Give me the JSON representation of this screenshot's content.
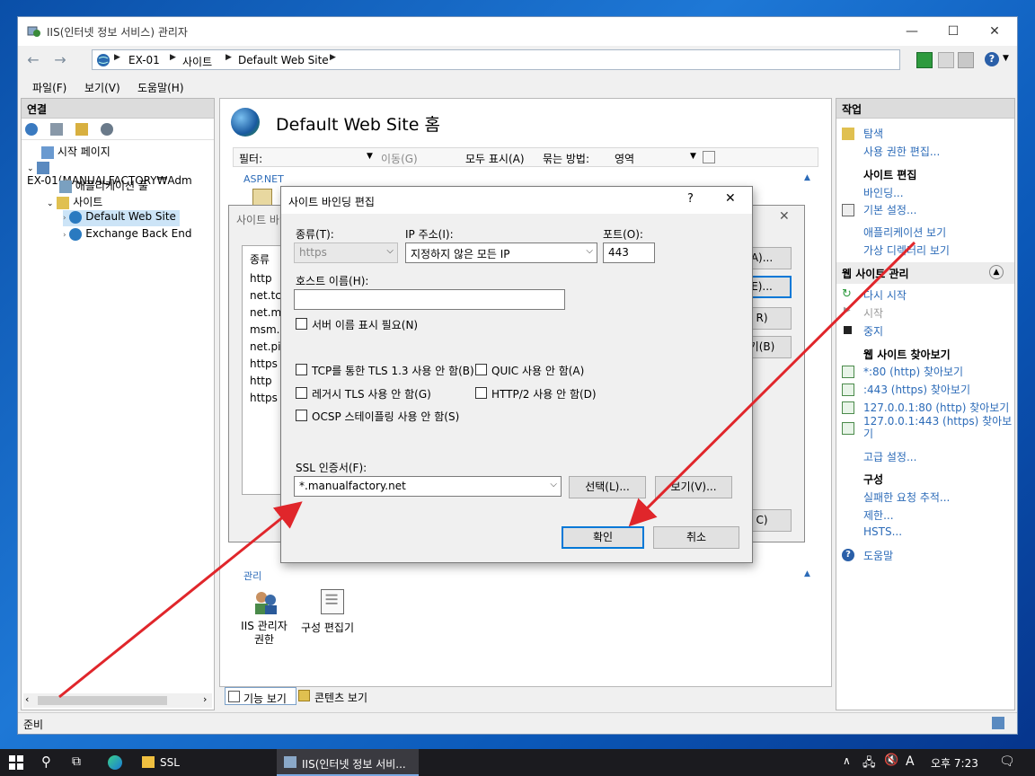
{
  "window": {
    "title": "IIS(인터넷 정보 서비스) 관리자",
    "buttons": {
      "minimize": "—",
      "maximize": "☐",
      "close": "✕"
    }
  },
  "address": {
    "crumbs": [
      "EX-01",
      "사이트",
      "Default Web Site"
    ]
  },
  "menu": {
    "file": "파일(F)",
    "view": "보기(V)",
    "help": "도움말(H)"
  },
  "left_pane": {
    "header": "연결",
    "tree": {
      "start_page": "시작 페이지",
      "server": "EX-01(MANUALFACTORY₩Adm",
      "app_pools": "애플리케이션 풀",
      "sites": "사이트",
      "default_site": "Default Web Site",
      "exchange": "Exchange Back End"
    }
  },
  "center": {
    "title": "Default Web Site 홈",
    "filter_label": "필터:",
    "go_label": "이동(G)",
    "show_all_label": "모두 표시(A)",
    "group_label": "묶는 방법:",
    "group_value": "영역",
    "section_aspnet": "ASP.NET",
    "section_manage": "관리",
    "icon_iis_perm": "IIS 관리자\n권한",
    "icon_config_editor": "구성 편집기",
    "tab_features": "기능 보기",
    "tab_content": "콘텐츠 보기"
  },
  "bindings_dialog": {
    "title": "사이트 바인딩",
    "col_type": "종류",
    "types": [
      "http",
      "net.tcp",
      "net.m...",
      "msm...",
      "net.pi...",
      "https",
      "http",
      "https"
    ],
    "btn_frags": [
      "A)...",
      "E)...",
      "R)",
      "기(B)",
      "C)"
    ]
  },
  "edit_dialog": {
    "title": "사이트 바인딩 편집",
    "help": "?",
    "close": "✕",
    "type_label": "종류(T):",
    "type_value": "https",
    "ip_label": "IP 주소(I):",
    "ip_value": "지정하지 않은 모든 IP",
    "port_label": "포트(O):",
    "port_value": "443",
    "host_label": "호스트 이름(H):",
    "host_value": "",
    "sni_label": "서버 이름 표시 필요(N)",
    "tls13_label": "TCP를 통한 TLS 1.3 사용 안 함(B)",
    "quic_label": "QUIC 사용 안 함(A)",
    "legacy_tls_label": "레거시 TLS 사용 안 함(G)",
    "http2_label": "HTTP/2 사용 안 함(D)",
    "ocsp_label": "OCSP 스테이플링 사용 안 함(S)",
    "ssl_label": "SSL 인증서(F):",
    "ssl_value": "*.manualfactory.net",
    "select_btn": "선택(L)...",
    "view_btn": "보기(V)...",
    "ok_btn": "확인",
    "cancel_btn": "취소"
  },
  "actions": {
    "header": "작업",
    "explore": "탐색",
    "edit_perm": "사용 권한 편집...",
    "edit_site_head": "사이트 편집",
    "bindings": "바인딩...",
    "basic_settings": "기본 설정...",
    "view_apps": "애플리케이션 보기",
    "view_vdirs": "가상 디렉터리 보기",
    "manage_head": "웹 사이트 관리",
    "restart": "다시 시작",
    "start": "시작",
    "stop": "중지",
    "browse_head": "웹 사이트 찾아보기",
    "browse1": "*:80 (http) 찾아보기",
    "browse2": ":443 (https) 찾아보기",
    "browse3": "127.0.0.1:80 (http) 찾아보기",
    "browse4": "127.0.0.1:443 (https) 찾아보\n기",
    "advanced": "고급 설정...",
    "config_head": "구성",
    "failed_req": "실패한 요청 추적...",
    "limits": "제한...",
    "hsts": "HSTS...",
    "help": "도움말"
  },
  "status": {
    "text": "준비"
  },
  "taskbar": {
    "ssl_folder": "SSL",
    "iis_task": "IIS(인터넷 정보 서비...",
    "ime": "A",
    "time": "오후 7:23"
  },
  "colors": {
    "link": "#2c6bb8",
    "accent": "#0078d7",
    "arrow": "#e0262b"
  }
}
